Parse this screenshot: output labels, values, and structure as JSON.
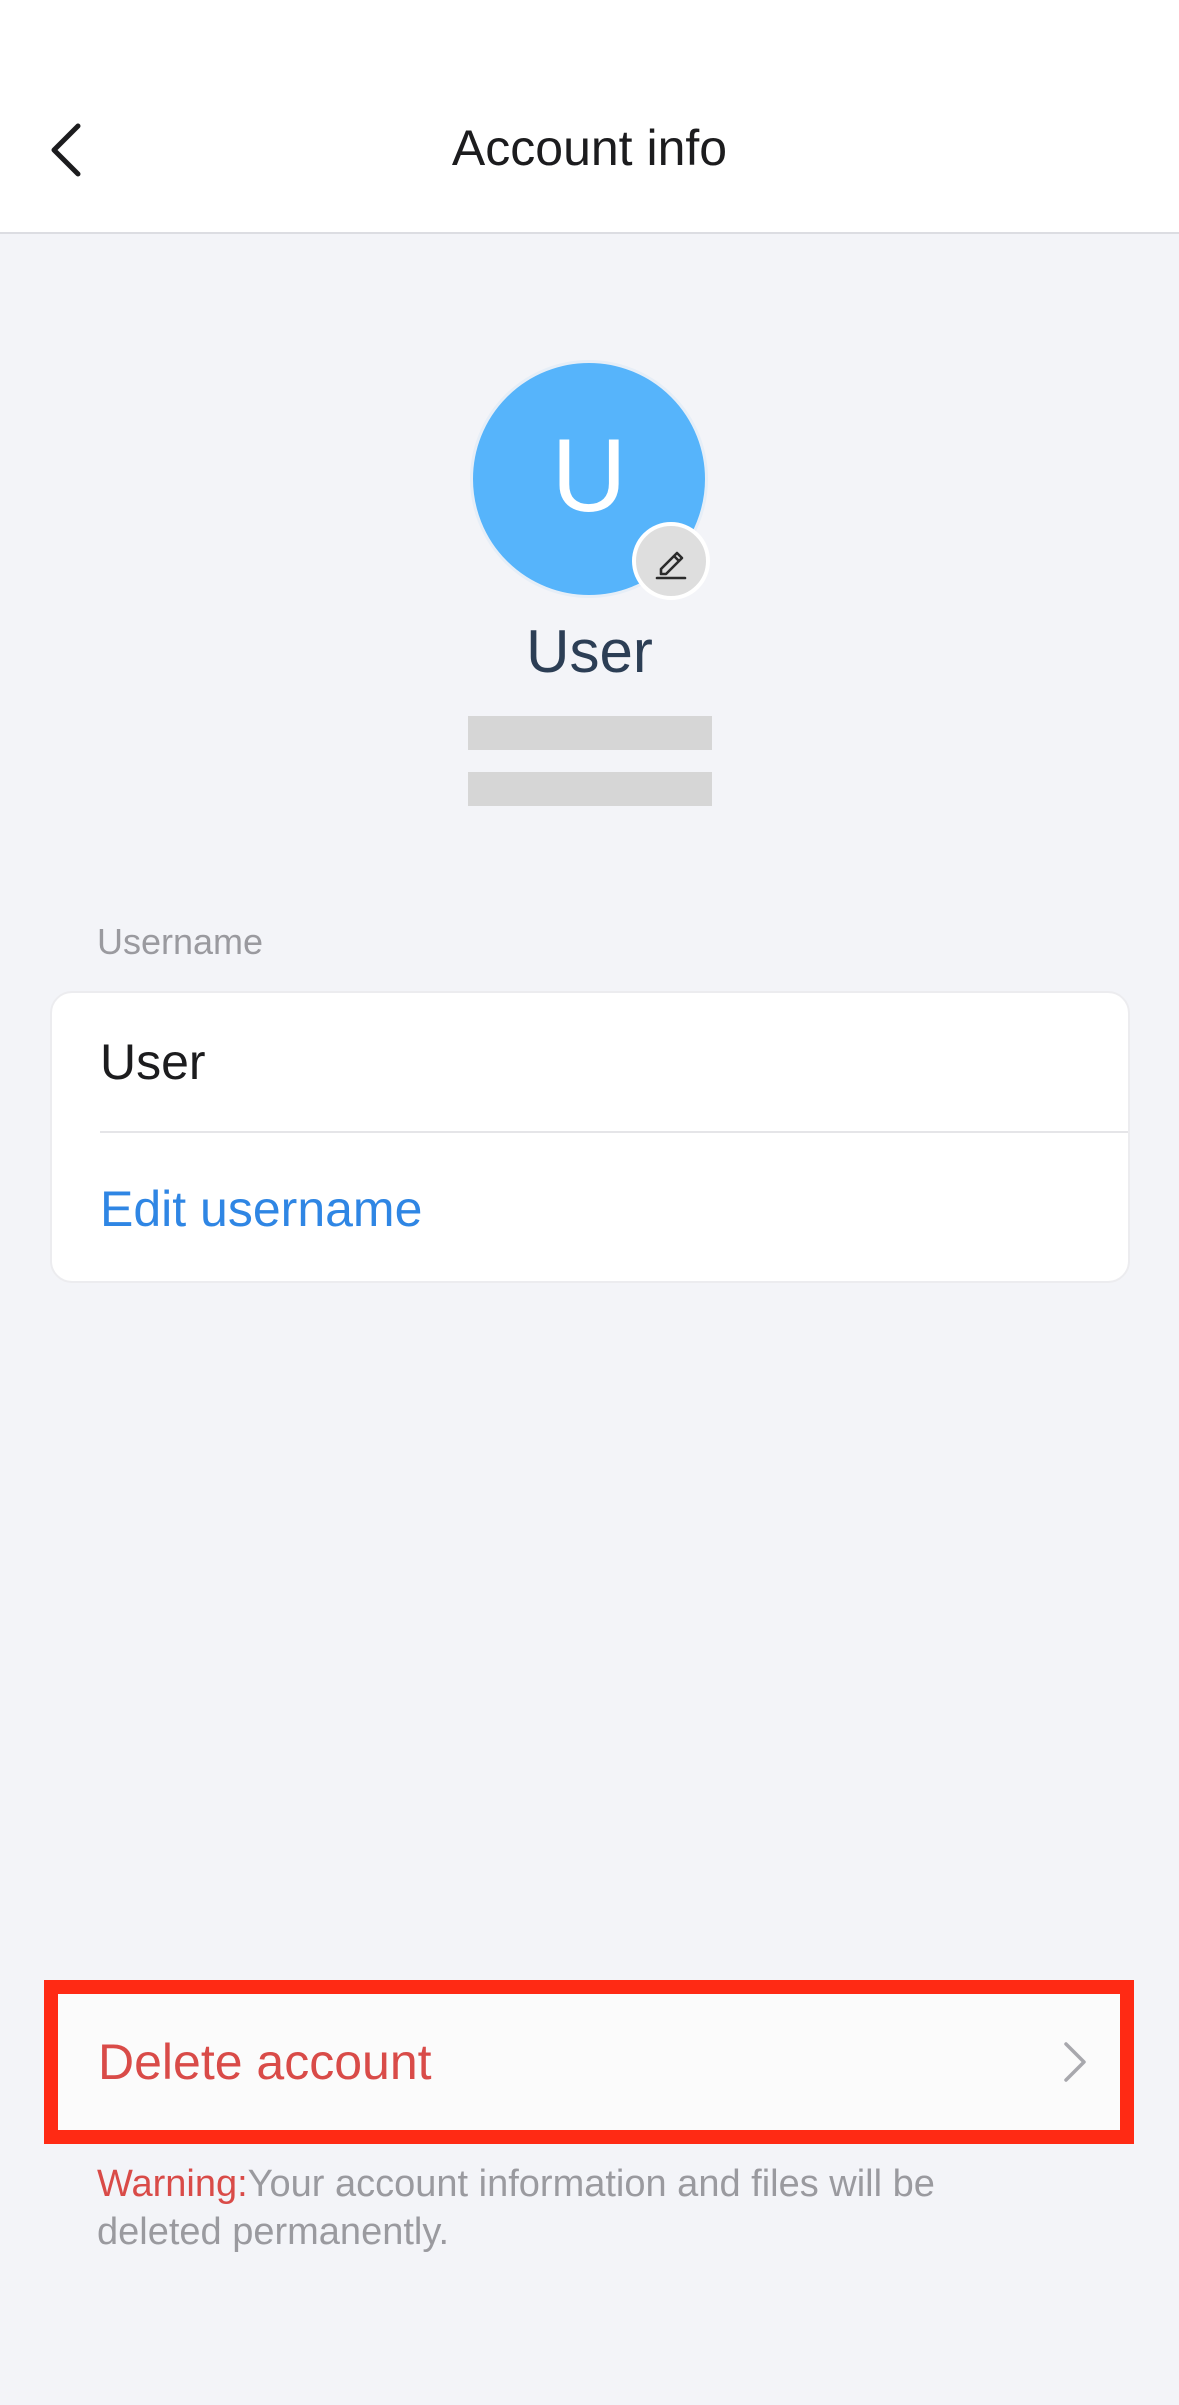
{
  "header": {
    "title": "Account info",
    "back_icon": "chevron-left-icon"
  },
  "profile": {
    "avatar_letter": "U",
    "avatar_color": "#56b4fb",
    "edit_icon": "pencil-icon",
    "name": "User"
  },
  "username_section": {
    "label": "Username",
    "value": "User",
    "edit_link": "Edit username",
    "link_color": "#2f86e4"
  },
  "danger_zone": {
    "delete_label": "Delete account",
    "chevron_icon": "chevron-right-icon",
    "warning_prefix": "Warning:",
    "warning_text": "Your account information and files will be deleted permanently.",
    "danger_color": "#d94b48",
    "highlight_color": "#ff2a14"
  }
}
